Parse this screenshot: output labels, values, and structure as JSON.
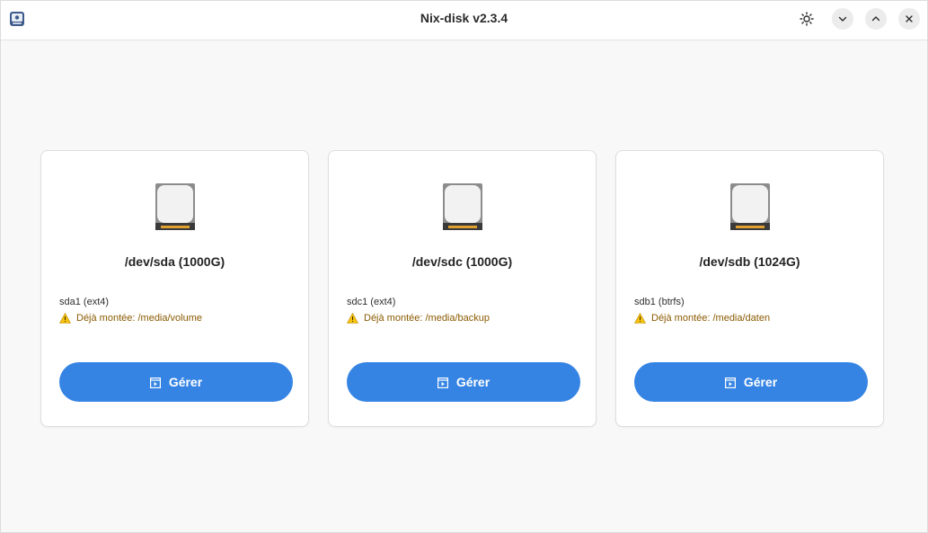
{
  "window": {
    "title": "Nix-disk v2.3.4",
    "app_icon": "disk-app-icon",
    "controls": [
      "brightness-icon",
      "chevron-down-icon",
      "chevron-up-icon",
      "close-icon"
    ]
  },
  "colors": {
    "accent": "#3584e4",
    "warning_text": "#8a5a00",
    "warning_icon": "#f5c211"
  },
  "disks": [
    {
      "name": "/dev/sda (1000G)",
      "partition": "sda1 (ext4)",
      "warning": "Déjà montée: /media/volume",
      "button_label": "Gérer",
      "icon": "hard-disk-icon"
    },
    {
      "name": "/dev/sdc (1000G)",
      "partition": "sdc1 (ext4)",
      "warning": "Déjà montée: /media/backup",
      "button_label": "Gérer",
      "icon": "hard-disk-icon"
    },
    {
      "name": "/dev/sdb (1024G)",
      "partition": "sdb1 (btrfs)",
      "warning": "Déjà montée: /media/daten",
      "button_label": "Gérer",
      "icon": "hard-disk-icon"
    }
  ]
}
